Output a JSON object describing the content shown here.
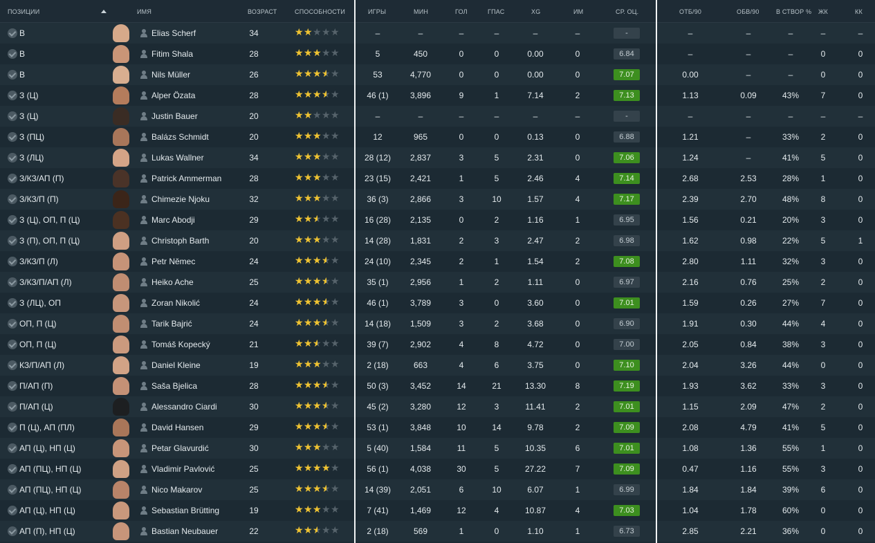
{
  "headers": {
    "position": "ПОЗИЦИИ",
    "name": "ИМЯ",
    "age": "ВОЗРАСТ",
    "ability": "СПОСОБНОСТИ",
    "apps": "ИГРЫ",
    "mins": "МИН",
    "goals": "ГОЛ",
    "assists": "ГПАС",
    "xg": "XG",
    "pom": "ИМ",
    "avg_rating": "СР. ОЦ.",
    "tackles": "ОТБ/90",
    "dribbles": "ОБВ/90",
    "shots_on_target": "В СТВОР %",
    "yellow": "ЖК",
    "red": "КК"
  },
  "colors": {
    "rating_high": "#3d8f1f",
    "rating_normal": "#34424b",
    "star": "#f0c330"
  },
  "players": [
    {
      "pos": "В",
      "name": "Elias Scherf",
      "age": "34",
      "stars": 2,
      "apps": "–",
      "mins": "–",
      "goals": "–",
      "assists": "–",
      "xg": "–",
      "pom": "–",
      "rating": "-",
      "high": false,
      "tck": "–",
      "drb": "–",
      "sot": "–",
      "yc": "–",
      "rc": "–",
      "skin": "#d6a98a"
    },
    {
      "pos": "В",
      "name": "Fitim Shala",
      "age": "28",
      "stars": 3,
      "apps": "5",
      "mins": "450",
      "goals": "0",
      "assists": "0",
      "xg": "0.00",
      "pom": "0",
      "rating": "6.84",
      "high": false,
      "tck": "–",
      "drb": "–",
      "sot": "–",
      "yc": "0",
      "rc": "0",
      "skin": "#c99577"
    },
    {
      "pos": "В",
      "name": "Nils Müller",
      "age": "26",
      "stars": 3.5,
      "apps": "53",
      "mins": "4,770",
      "goals": "0",
      "assists": "0",
      "xg": "0.00",
      "pom": "0",
      "rating": "7.07",
      "high": true,
      "tck": "0.00",
      "drb": "–",
      "sot": "–",
      "yc": "0",
      "rc": "0",
      "skin": "#d8ae90"
    },
    {
      "pos": "З (Ц)",
      "name": "Alper Özata",
      "age": "28",
      "stars": 3.5,
      "apps": "46 (1)",
      "mins": "3,896",
      "goals": "9",
      "assists": "1",
      "xg": "7.14",
      "pom": "2",
      "rating": "7.13",
      "high": true,
      "tck": "1.13",
      "drb": "0.09",
      "sot": "43%",
      "yc": "7",
      "rc": "0",
      "skin": "#b47c5c"
    },
    {
      "pos": "З (Ц)",
      "name": "Justin Bauer",
      "age": "20",
      "stars": 2,
      "apps": "–",
      "mins": "–",
      "goals": "–",
      "assists": "–",
      "xg": "–",
      "pom": "–",
      "rating": "-",
      "high": false,
      "tck": "–",
      "drb": "–",
      "sot": "–",
      "yc": "–",
      "rc": "–",
      "skin": "#3a2c24"
    },
    {
      "pos": "З (ПЦ)",
      "name": "Balázs Schmidt",
      "age": "20",
      "stars": 3,
      "apps": "12",
      "mins": "965",
      "goals": "0",
      "assists": "0",
      "xg": "0.13",
      "pom": "0",
      "rating": "6.88",
      "high": false,
      "tck": "1.21",
      "drb": "–",
      "sot": "33%",
      "yc": "2",
      "rc": "0",
      "skin": "#a8765a"
    },
    {
      "pos": "З (ЛЦ)",
      "name": "Lukas Wallner",
      "age": "34",
      "stars": 3,
      "apps": "28 (12)",
      "mins": "2,837",
      "goals": "3",
      "assists": "5",
      "xg": "2.31",
      "pom": "0",
      "rating": "7.06",
      "high": true,
      "tck": "1.24",
      "drb": "–",
      "sot": "41%",
      "yc": "5",
      "rc": "0",
      "skin": "#d4a487"
    },
    {
      "pos": "З/КЗ/АП (П)",
      "name": "Patrick Ammerman",
      "age": "28",
      "stars": 3,
      "apps": "23 (15)",
      "mins": "2,421",
      "goals": "1",
      "assists": "5",
      "xg": "2.46",
      "pom": "4",
      "rating": "7.14",
      "high": true,
      "tck": "2.68",
      "drb": "2.53",
      "sot": "28%",
      "yc": "1",
      "rc": "0",
      "skin": "#4a3328"
    },
    {
      "pos": "З/КЗ/П (П)",
      "name": "Chimezie Njoku",
      "age": "32",
      "stars": 3,
      "apps": "36 (3)",
      "mins": "2,866",
      "goals": "3",
      "assists": "10",
      "xg": "1.57",
      "pom": "4",
      "rating": "7.17",
      "high": true,
      "tck": "2.39",
      "drb": "2.70",
      "sot": "48%",
      "yc": "8",
      "rc": "0",
      "skin": "#3b2519"
    },
    {
      "pos": "З (Ц), ОП, П (Ц)",
      "name": "Marc Abodji",
      "age": "29",
      "stars": 2.5,
      "apps": "16 (28)",
      "mins": "2,135",
      "goals": "0",
      "assists": "2",
      "xg": "1.16",
      "pom": "1",
      "rating": "6.95",
      "high": false,
      "tck": "1.56",
      "drb": "0.21",
      "sot": "20%",
      "yc": "3",
      "rc": "0",
      "skin": "#4b3122"
    },
    {
      "pos": "З (П), ОП, П (Ц)",
      "name": "Christoph Barth",
      "age": "20",
      "stars": 3,
      "apps": "14 (28)",
      "mins": "1,831",
      "goals": "2",
      "assists": "3",
      "xg": "2.47",
      "pom": "2",
      "rating": "6.98",
      "high": false,
      "tck": "1.62",
      "drb": "0.98",
      "sot": "22%",
      "yc": "5",
      "rc": "1",
      "skin": "#cf9f83"
    },
    {
      "pos": "З/КЗ/П (Л)",
      "name": "Petr Němec",
      "age": "24",
      "stars": 3.5,
      "apps": "24 (10)",
      "mins": "2,345",
      "goals": "2",
      "assists": "1",
      "xg": "1.54",
      "pom": "2",
      "rating": "7.08",
      "high": true,
      "tck": "2.80",
      "drb": "1.11",
      "sot": "32%",
      "yc": "3",
      "rc": "0",
      "skin": "#c69378"
    },
    {
      "pos": "З/КЗ/П/АП (Л)",
      "name": "Heiko Ache",
      "age": "25",
      "stars": 3.5,
      "apps": "35 (1)",
      "mins": "2,956",
      "goals": "1",
      "assists": "2",
      "xg": "1.11",
      "pom": "0",
      "rating": "6.97",
      "high": false,
      "tck": "2.16",
      "drb": "0.76",
      "sot": "25%",
      "yc": "2",
      "rc": "0",
      "skin": "#c08d72"
    },
    {
      "pos": "З (ЛЦ), ОП",
      "name": "Zoran Nikolić",
      "age": "24",
      "stars": 3.5,
      "apps": "46 (1)",
      "mins": "3,789",
      "goals": "3",
      "assists": "0",
      "xg": "3.60",
      "pom": "0",
      "rating": "7.01",
      "high": true,
      "tck": "1.59",
      "drb": "0.26",
      "sot": "27%",
      "yc": "7",
      "rc": "0",
      "skin": "#c7967b"
    },
    {
      "pos": "ОП, П (Ц)",
      "name": "Tarik Bajrić",
      "age": "24",
      "stars": 3.5,
      "apps": "14 (18)",
      "mins": "1,509",
      "goals": "3",
      "assists": "2",
      "xg": "3.68",
      "pom": "0",
      "rating": "6.90",
      "high": false,
      "tck": "1.91",
      "drb": "0.30",
      "sot": "44%",
      "yc": "4",
      "rc": "0",
      "skin": "#c18e72"
    },
    {
      "pos": "ОП, П (Ц)",
      "name": "Tomáš Kopecký",
      "age": "21",
      "stars": 2.5,
      "apps": "39 (7)",
      "mins": "2,902",
      "goals": "4",
      "assists": "8",
      "xg": "4.72",
      "pom": "0",
      "rating": "7.00",
      "high": false,
      "tck": "2.05",
      "drb": "0.84",
      "sot": "38%",
      "yc": "3",
      "rc": "0",
      "skin": "#cb9a7e"
    },
    {
      "pos": "КЗ/П/АП (Л)",
      "name": "Daniel Kleine",
      "age": "19",
      "stars": 3,
      "apps": "2 (18)",
      "mins": "663",
      "goals": "4",
      "assists": "6",
      "xg": "3.75",
      "pom": "0",
      "rating": "7.10",
      "high": true,
      "tck": "2.04",
      "drb": "3.26",
      "sot": "44%",
      "yc": "0",
      "rc": "0",
      "skin": "#d2a386"
    },
    {
      "pos": "П/АП (П)",
      "name": "Saša Bjelica",
      "age": "28",
      "stars": 3.5,
      "apps": "50 (3)",
      "mins": "3,452",
      "goals": "14",
      "assists": "21",
      "xg": "13.30",
      "pom": "8",
      "rating": "7.19",
      "high": true,
      "tck": "1.93",
      "drb": "3.62",
      "sot": "33%",
      "yc": "3",
      "rc": "0",
      "skin": "#c49176"
    },
    {
      "pos": "П/АП (Ц)",
      "name": "Alessandro Ciardi",
      "age": "30",
      "stars": 3.5,
      "apps": "45 (2)",
      "mins": "3,280",
      "goals": "12",
      "assists": "3",
      "xg": "11.41",
      "pom": "2",
      "rating": "7.01",
      "high": true,
      "tck": "1.15",
      "drb": "2.09",
      "sot": "47%",
      "yc": "2",
      "rc": "0",
      "skin": "#1d1f21"
    },
    {
      "pos": "П (Ц), АП (ПЛ)",
      "name": "David Hansen",
      "age": "29",
      "stars": 3.5,
      "apps": "53 (1)",
      "mins": "3,848",
      "goals": "10",
      "assists": "14",
      "xg": "9.78",
      "pom": "2",
      "rating": "7.09",
      "high": true,
      "tck": "2.08",
      "drb": "4.79",
      "sot": "41%",
      "yc": "5",
      "rc": "0",
      "skin": "#a97659"
    },
    {
      "pos": "АП (Ц), НП (Ц)",
      "name": "Petar Glavurdić",
      "age": "30",
      "stars": 3,
      "apps": "5 (40)",
      "mins": "1,584",
      "goals": "11",
      "assists": "5",
      "xg": "10.35",
      "pom": "6",
      "rating": "7.01",
      "high": true,
      "tck": "1.08",
      "drb": "1.36",
      "sot": "55%",
      "yc": "1",
      "rc": "0",
      "skin": "#c89579"
    },
    {
      "pos": "АП (ПЦ), НП (Ц)",
      "name": "Vladimir Pavlović",
      "age": "25",
      "stars": 4,
      "apps": "56 (1)",
      "mins": "4,038",
      "goals": "30",
      "assists": "5",
      "xg": "27.22",
      "pom": "7",
      "rating": "7.09",
      "high": true,
      "tck": "0.47",
      "drb": "1.16",
      "sot": "55%",
      "yc": "3",
      "rc": "0",
      "skin": "#ceA084"
    },
    {
      "pos": "АП (ПЦ), НП (Ц)",
      "name": "Nico Makarov",
      "age": "25",
      "stars": 3.5,
      "apps": "14 (39)",
      "mins": "2,051",
      "goals": "6",
      "assists": "10",
      "xg": "6.07",
      "pom": "1",
      "rating": "6.99",
      "high": false,
      "tck": "1.84",
      "drb": "1.84",
      "sot": "39%",
      "yc": "6",
      "rc": "0",
      "skin": "#b98469"
    },
    {
      "pos": "АП (Ц), НП (Ц)",
      "name": "Sebastian Brütting",
      "age": "19",
      "stars": 3,
      "apps": "7 (41)",
      "mins": "1,469",
      "goals": "12",
      "assists": "4",
      "xg": "10.87",
      "pom": "4",
      "rating": "7.03",
      "high": true,
      "tck": "1.04",
      "drb": "1.78",
      "sot": "60%",
      "yc": "0",
      "rc": "0",
      "skin": "#c9987c"
    },
    {
      "pos": "АП (П), НП (Ц)",
      "name": "Bastian Neubauer",
      "age": "22",
      "stars": 2.5,
      "apps": "2 (18)",
      "mins": "569",
      "goals": "1",
      "assists": "0",
      "xg": "1.10",
      "pom": "1",
      "rating": "6.73",
      "high": false,
      "tck": "2.85",
      "drb": "2.21",
      "sot": "36%",
      "yc": "0",
      "rc": "0",
      "skin": "#c7957a"
    }
  ]
}
